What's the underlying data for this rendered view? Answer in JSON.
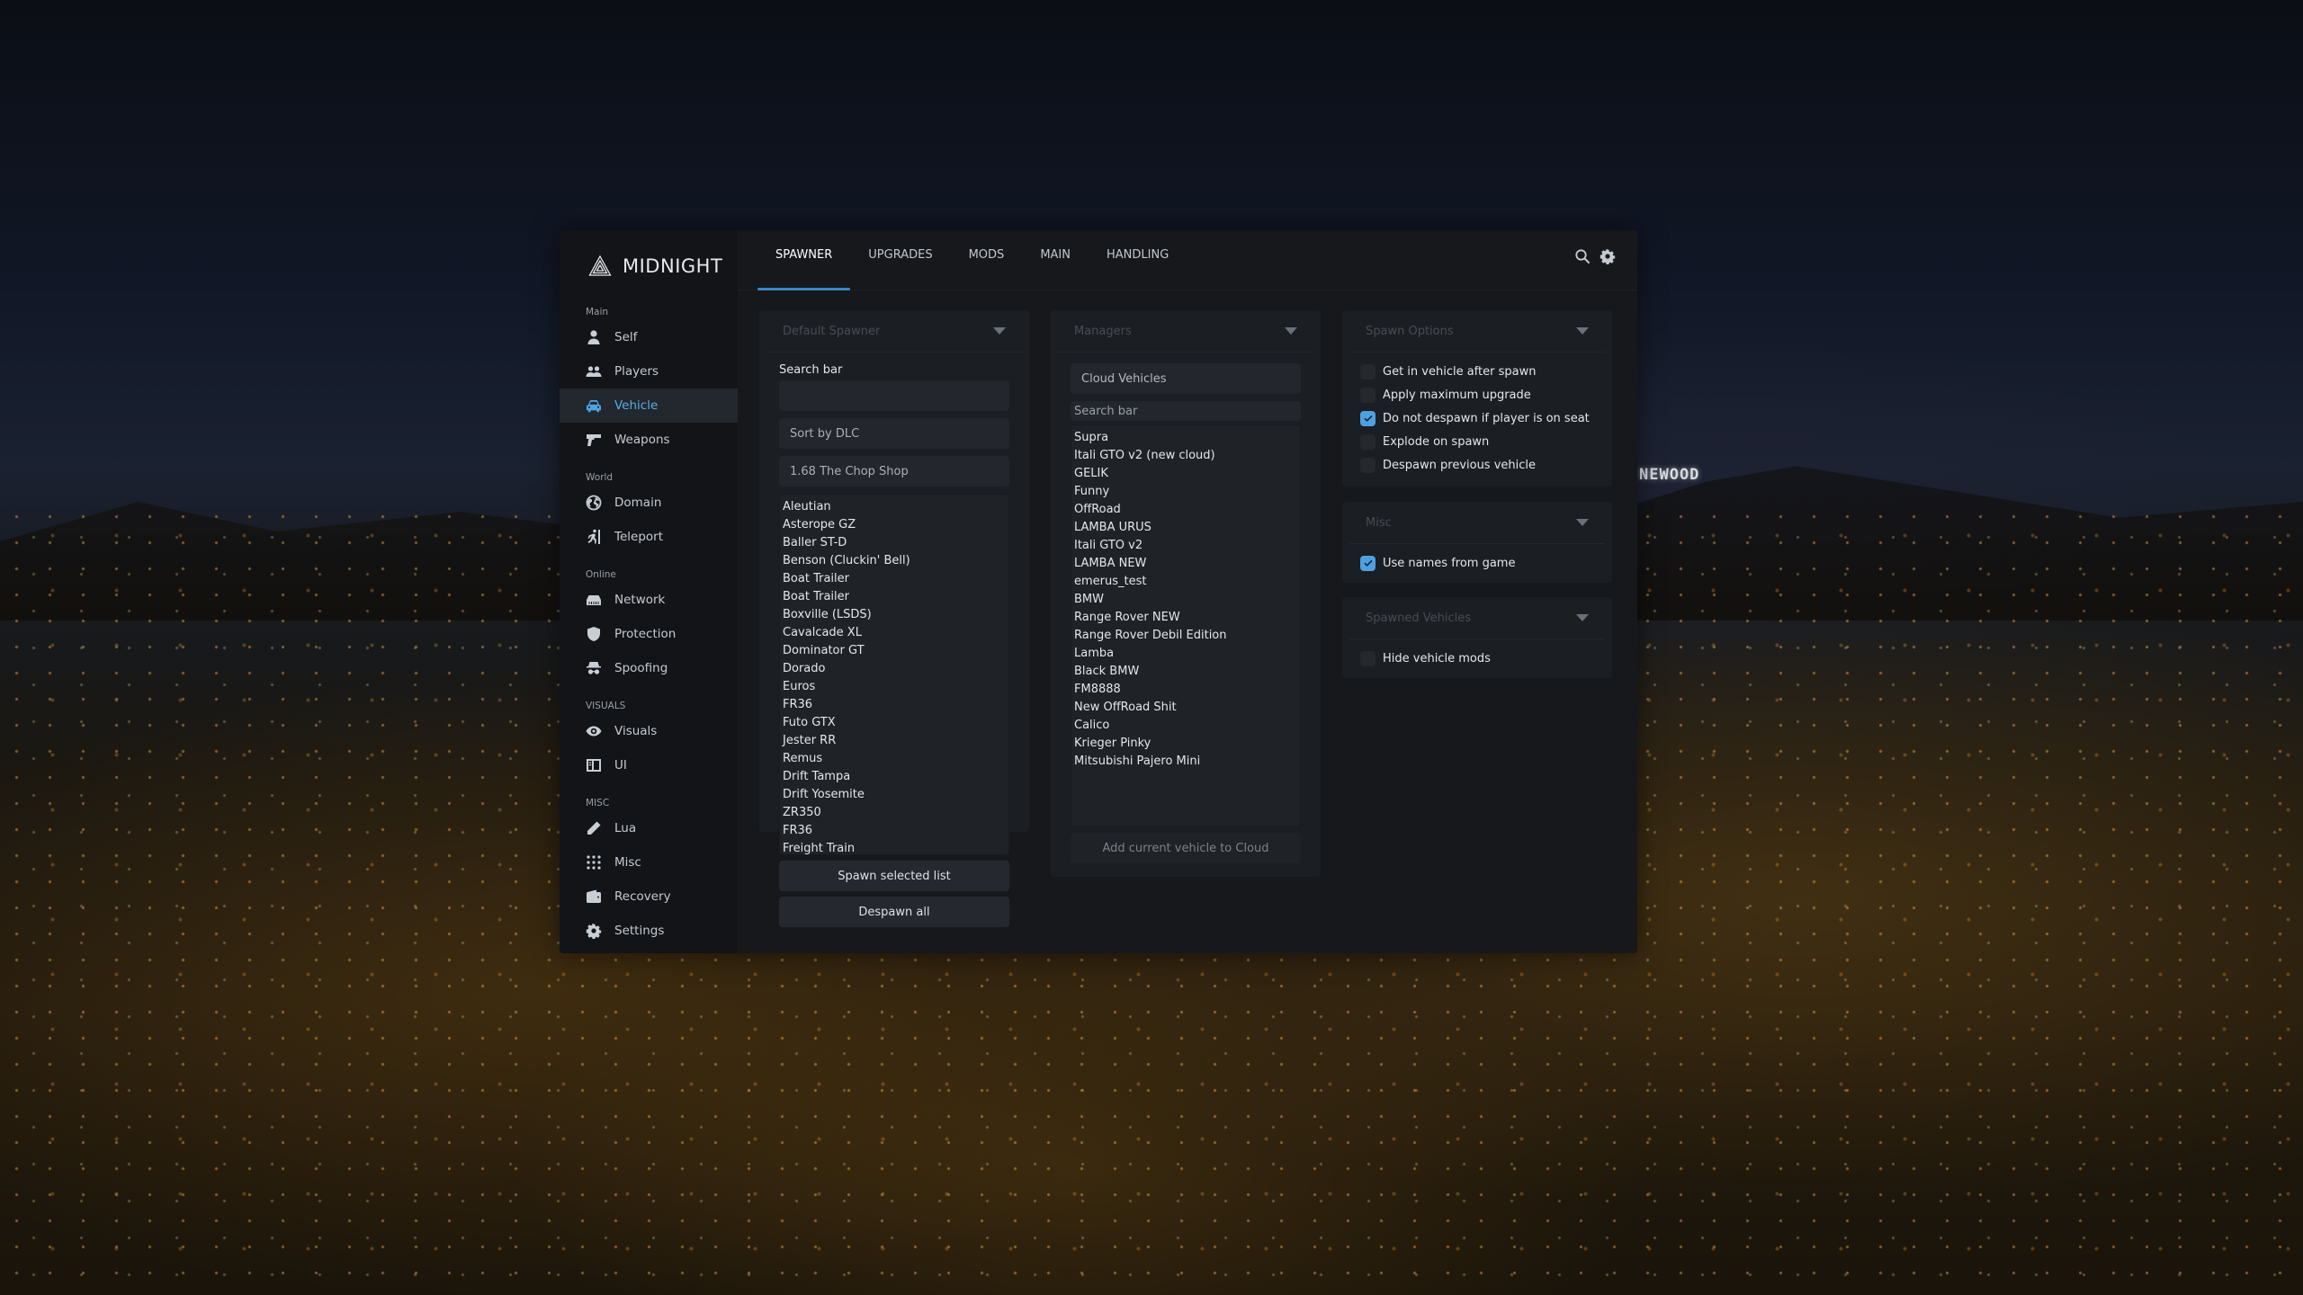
{
  "background": {
    "sign_text": "NEWOOD"
  },
  "brand": {
    "name": "MIDNIGHT",
    "icon": "impossible-triangle-logo"
  },
  "sidebar": {
    "sections": [
      {
        "title": "Main",
        "items": [
          {
            "label": "Self",
            "icon": "user-icon",
            "active": false
          },
          {
            "label": "Players",
            "icon": "users-icon",
            "active": false
          },
          {
            "label": "Vehicle",
            "icon": "car-icon",
            "active": true
          },
          {
            "label": "Weapons",
            "icon": "gun-icon",
            "active": false
          }
        ]
      },
      {
        "title": "World",
        "items": [
          {
            "label": "Domain",
            "icon": "globe-icon",
            "active": false
          },
          {
            "label": "Teleport",
            "icon": "running-person-icon",
            "active": false
          }
        ]
      },
      {
        "title": "Online",
        "items": [
          {
            "label": "Network",
            "icon": "ethernet-icon",
            "active": false
          },
          {
            "label": "Protection",
            "icon": "shield-icon",
            "active": false
          },
          {
            "label": "Spoofing",
            "icon": "spy-icon",
            "active": false
          }
        ]
      },
      {
        "title": "VISUALS",
        "items": [
          {
            "label": "Visuals",
            "icon": "eye-icon",
            "active": false
          },
          {
            "label": "UI",
            "icon": "layout-icon",
            "active": false
          }
        ]
      },
      {
        "title": "MISC",
        "items": [
          {
            "label": "Lua",
            "icon": "pencil-icon",
            "active": false
          },
          {
            "label": "Misc",
            "icon": "grid-dots-icon",
            "active": false
          },
          {
            "label": "Recovery",
            "icon": "wallet-icon",
            "active": false
          },
          {
            "label": "Settings",
            "icon": "gear-icon",
            "active": false
          }
        ]
      }
    ]
  },
  "tabs": [
    {
      "label": "SPAWNER",
      "active": true
    },
    {
      "label": "UPGRADES",
      "active": false
    },
    {
      "label": "MODS",
      "active": false
    },
    {
      "label": "MAIN",
      "active": false
    },
    {
      "label": "HANDLING",
      "active": false
    }
  ],
  "top_icons": [
    "search-icon",
    "gear-icon"
  ],
  "colors": {
    "accent": "#4ea1e0",
    "tab_underline": "#3f86c4",
    "panel": "#16181c",
    "sidebar": "#121417"
  },
  "default_spawner": {
    "title": "Default Spawner",
    "search_label": "Search bar",
    "search_value": "",
    "sort_select": "Sort by DLC",
    "dlc_select": "1.68 The Chop Shop",
    "vehicles": [
      "Aleutian",
      "Asterope GZ",
      "Baller ST-D",
      "Benson (Cluckin' Bell)",
      "Boat Trailer",
      "Boat Trailer",
      "Boxville (LSDS)",
      "Cavalcade XL",
      "Dominator GT",
      "Dorado",
      "Euros",
      "FR36",
      "Futo GTX",
      "Jester RR",
      "Remus",
      "Drift Tampa",
      "Drift Yosemite",
      "ZR350",
      "FR36",
      "Freight Train"
    ],
    "spawn_button": "Spawn selected list",
    "despawn_button": "Despawn all"
  },
  "managers": {
    "title": "Managers",
    "category_select": "Cloud Vehicles",
    "search_placeholder": "Search bar",
    "vehicles": [
      "Supra",
      "Itali GTO v2 (new cloud)",
      "GELIK",
      "Funny",
      "OffRoad",
      "LAMBA URUS",
      "Itali GTO v2",
      "LAMBA NEW",
      "emerus_test",
      "BMW",
      "Range Rover NEW",
      "Range Rover Debil Edition",
      "Lamba",
      "Black BMW",
      "FM8888",
      "New OffRoad Shit",
      "Calico",
      "Krieger Pinky",
      "Mitsubishi Pajero Mini"
    ],
    "add_button": "Add current vehicle to Cloud"
  },
  "spawn_options": {
    "title": "Spawn Options",
    "options": [
      {
        "label": "Get in vehicle after spawn",
        "checked": false
      },
      {
        "label": "Apply maximum upgrade",
        "checked": false
      },
      {
        "label": "Do not despawn if player is on seat",
        "checked": true
      },
      {
        "label": "Explode on spawn",
        "checked": false
      },
      {
        "label": "Despawn previous vehicle",
        "checked": false
      }
    ]
  },
  "misc": {
    "title": "Misc",
    "options": [
      {
        "label": "Use names from game",
        "checked": true
      }
    ]
  },
  "spawned_vehicles": {
    "title": "Spawned Vehicles",
    "options": [
      {
        "label": "Hide vehicle mods",
        "checked": false
      }
    ]
  }
}
